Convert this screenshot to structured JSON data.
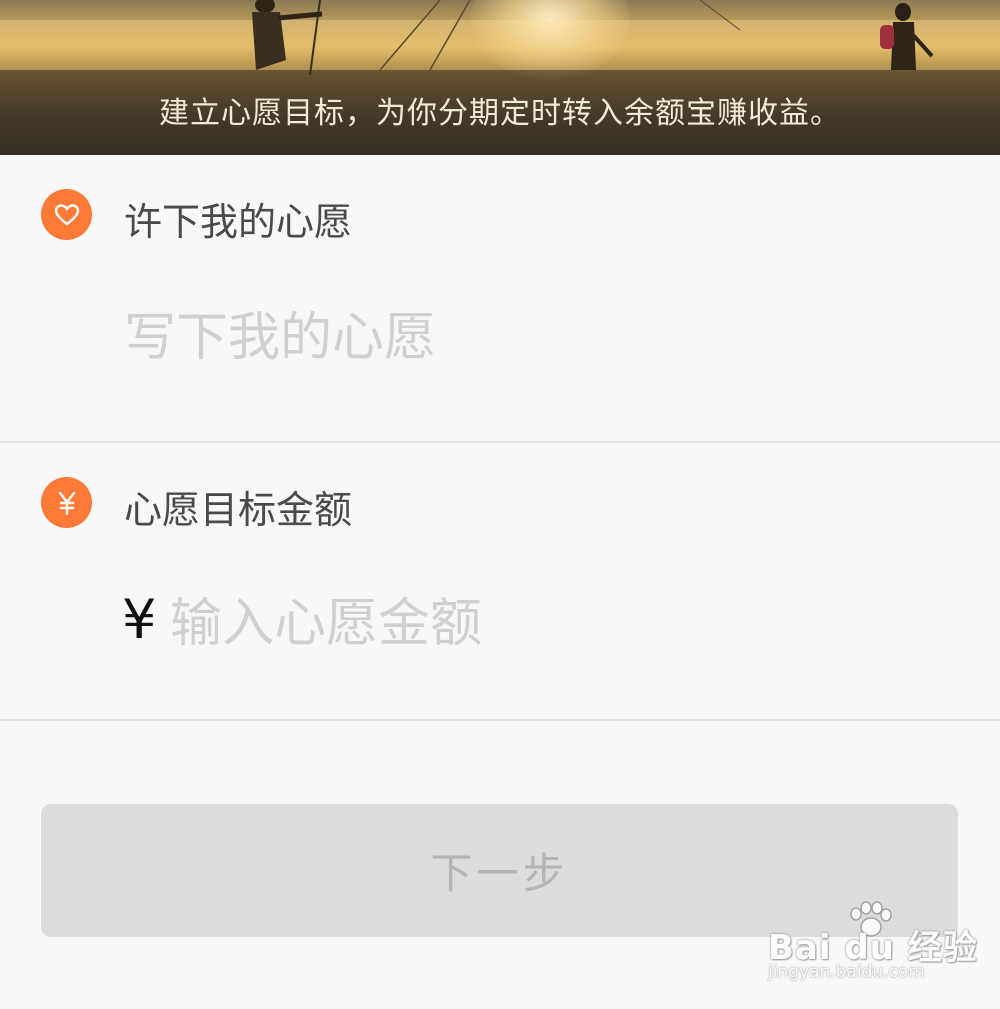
{
  "banner": {
    "caption": "建立心愿目标，为你分期定时转入余额宝赚收益。"
  },
  "wish_section": {
    "icon": "heart-icon",
    "title": "许下我的心愿",
    "input_placeholder": "写下我的心愿",
    "input_value": ""
  },
  "amount_section": {
    "icon": "yen-icon",
    "title": "心愿目标金额",
    "currency_symbol": "¥",
    "input_placeholder": "输入心愿金额",
    "input_value": ""
  },
  "next_button": {
    "label": "下一步",
    "enabled": false
  },
  "watermark": {
    "brand": "Bai du 经验",
    "url": "jingyan.baidu.com"
  },
  "colors": {
    "accent": "#fe7a36",
    "button_disabled_bg": "#dcdcdc",
    "button_disabled_text": "#b4b4b4",
    "placeholder": "#d0d0d0"
  }
}
